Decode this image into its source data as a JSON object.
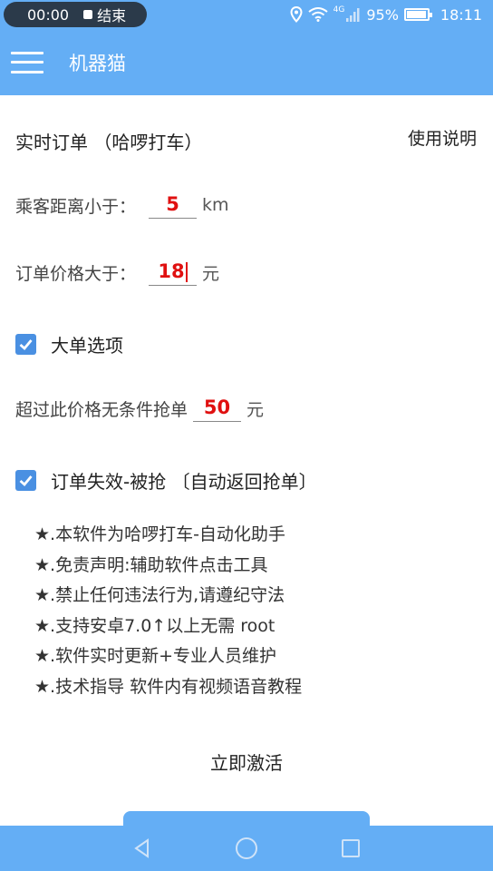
{
  "status_bar": {
    "record_time": "00:00",
    "record_stop_label": "结束",
    "battery_percent": "95%",
    "battery_level": 0.95,
    "network_label": "4G",
    "clock": "18:11",
    "icons": [
      "location-icon",
      "wifi-icon",
      "signal-icon",
      "battery-icon"
    ]
  },
  "app_bar": {
    "title": "机器猫",
    "menu_icon": "hamburger-menu-icon"
  },
  "header": {
    "title": "实时订单 （哈啰打车）",
    "help_link": "使用说明"
  },
  "distance": {
    "label": "乘客距离小于：",
    "value": "5",
    "unit": "km"
  },
  "price": {
    "label": "订单价格大于：",
    "value": "18",
    "unit": "元"
  },
  "big_order": {
    "checked": true,
    "label": "大单选项"
  },
  "threshold": {
    "label": "超过此价格无条件抢单",
    "value": "50",
    "unit": "元"
  },
  "auto_return": {
    "checked": true,
    "label": "订单失效-被抢 〔自动返回抢单〕"
  },
  "notes": [
    "★.本软件为哈啰打车-自动化助手",
    "★.免责声明:辅助软件点击工具",
    "★.禁止任何违法行为,请遵纪守法",
    "★.支持安卓7.0↑以上无需 root",
    "★.软件实时更新+专业人员维护",
    "★.技术指导 软件内有视频语音教程"
  ],
  "activate_label": "立即激活",
  "colors": {
    "primary": "#64aef5",
    "checkbox": "#4a90e2",
    "value_red": "#e01010"
  },
  "nav_icons": [
    "back-icon",
    "home-icon",
    "recents-icon"
  ]
}
